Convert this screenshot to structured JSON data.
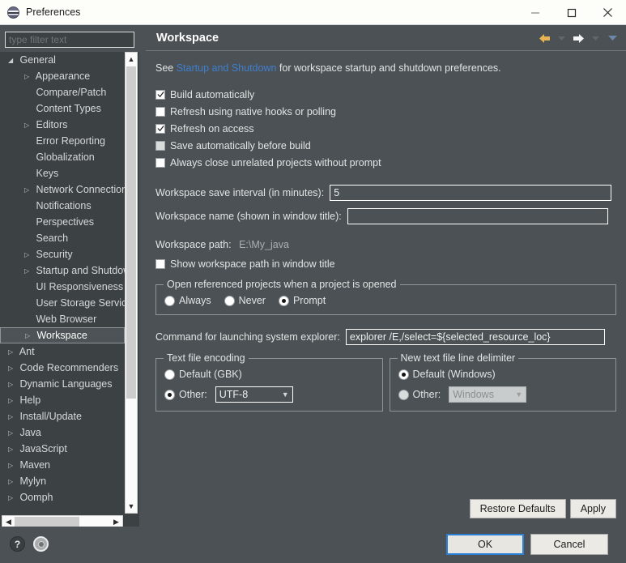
{
  "window": {
    "title": "Preferences",
    "app_icon": "eclipse-icon",
    "controls": {
      "minimize": "minimize-icon",
      "maximize": "maximize-icon",
      "close": "close-icon"
    }
  },
  "sidebar": {
    "filter_placeholder": "type filter text",
    "filter_value": "",
    "items": [
      {
        "label": "General",
        "level": 1,
        "arrow": "expanded",
        "selected": false
      },
      {
        "label": "Appearance",
        "level": 2,
        "arrow": "collapsed",
        "selected": false
      },
      {
        "label": "Compare/Patch",
        "level": 2,
        "arrow": "none",
        "selected": false
      },
      {
        "label": "Content Types",
        "level": 2,
        "arrow": "none",
        "selected": false
      },
      {
        "label": "Editors",
        "level": 2,
        "arrow": "collapsed",
        "selected": false
      },
      {
        "label": "Error Reporting",
        "level": 2,
        "arrow": "none",
        "selected": false
      },
      {
        "label": "Globalization",
        "level": 2,
        "arrow": "none",
        "selected": false
      },
      {
        "label": "Keys",
        "level": 2,
        "arrow": "none",
        "selected": false
      },
      {
        "label": "Network Connections",
        "level": 2,
        "arrow": "collapsed",
        "selected": false
      },
      {
        "label": "Notifications",
        "level": 2,
        "arrow": "none",
        "selected": false
      },
      {
        "label": "Perspectives",
        "level": 2,
        "arrow": "none",
        "selected": false
      },
      {
        "label": "Search",
        "level": 2,
        "arrow": "none",
        "selected": false
      },
      {
        "label": "Security",
        "level": 2,
        "arrow": "collapsed",
        "selected": false
      },
      {
        "label": "Startup and Shutdown",
        "level": 2,
        "arrow": "collapsed",
        "selected": false
      },
      {
        "label": "UI Responsiveness Monitoring",
        "level": 2,
        "arrow": "none",
        "selected": false
      },
      {
        "label": "User Storage Service",
        "level": 2,
        "arrow": "none",
        "selected": false
      },
      {
        "label": "Web Browser",
        "level": 2,
        "arrow": "none",
        "selected": false
      },
      {
        "label": "Workspace",
        "level": 2,
        "arrow": "collapsed",
        "selected": true
      },
      {
        "label": "Ant",
        "level": 1,
        "arrow": "collapsed",
        "selected": false
      },
      {
        "label": "Code Recommenders",
        "level": 1,
        "arrow": "collapsed",
        "selected": false
      },
      {
        "label": "Dynamic Languages",
        "level": 1,
        "arrow": "collapsed",
        "selected": false
      },
      {
        "label": "Help",
        "level": 1,
        "arrow": "collapsed",
        "selected": false
      },
      {
        "label": "Install/Update",
        "level": 1,
        "arrow": "collapsed",
        "selected": false
      },
      {
        "label": "Java",
        "level": 1,
        "arrow": "collapsed",
        "selected": false
      },
      {
        "label": "JavaScript",
        "level": 1,
        "arrow": "collapsed",
        "selected": false
      },
      {
        "label": "Maven",
        "level": 1,
        "arrow": "collapsed",
        "selected": false
      },
      {
        "label": "Mylyn",
        "level": 1,
        "arrow": "collapsed",
        "selected": false
      },
      {
        "label": "Oomph",
        "level": 1,
        "arrow": "collapsed",
        "selected": false
      }
    ],
    "scroll_up_icon": "chevron-up-icon",
    "scroll_down_icon": "chevron-down-icon",
    "scroll_left_icon": "chevron-left-icon",
    "scroll_right_icon": "chevron-right-icon"
  },
  "page": {
    "title": "Workspace",
    "nav": {
      "back_icon": "back-arrow-icon",
      "back_menu_icon": "chevron-down-icon",
      "forward_icon": "forward-arrow-icon",
      "forward_menu_icon": "chevron-down-icon",
      "view_menu_icon": "chevron-down-icon",
      "back_color": "#e8b452",
      "forward_color": "#f4f6f7",
      "menu_color": "#6d87a8"
    },
    "description": {
      "prefix": "See ",
      "link": "Startup and Shutdown",
      "suffix": " for workspace startup and shutdown preferences."
    },
    "checkboxes": [
      {
        "label": "Build automatically",
        "checked": true,
        "enabled": true
      },
      {
        "label": "Refresh using native hooks or polling",
        "checked": false,
        "enabled": true
      },
      {
        "label": "Refresh on access",
        "checked": true,
        "enabled": true
      },
      {
        "label": "Save automatically before build",
        "checked": false,
        "enabled": false
      },
      {
        "label": "Always close unrelated projects without prompt",
        "checked": false,
        "enabled": true
      }
    ],
    "save_interval": {
      "label": "Workspace save interval (in minutes):",
      "value": "5"
    },
    "workspace_name": {
      "label": "Workspace name (shown in window title):",
      "value": ""
    },
    "workspace_path": {
      "label": "Workspace path:",
      "value": "E:\\My_java"
    },
    "show_path_checkbox": {
      "label": "Show workspace path in window title",
      "checked": false
    },
    "open_referenced": {
      "title": "Open referenced projects when a project is opened",
      "options": [
        "Always",
        "Never",
        "Prompt"
      ],
      "selected": "Prompt"
    },
    "explorer_command": {
      "label": "Command for launching system explorer:",
      "value": "explorer /E,/select=${selected_resource_loc}"
    },
    "text_file_encoding": {
      "title": "Text file encoding",
      "default_label": "Default (GBK)",
      "other_label": "Other:",
      "selected": "Other",
      "combo_value": "UTF-8",
      "combo_arrow_icon": "chevron-down-icon"
    },
    "line_delimiter": {
      "title": "New text file line delimiter",
      "default_label": "Default (Windows)",
      "other_label": "Other:",
      "selected": "Default",
      "combo_value": "Windows",
      "combo_arrow_icon": "chevron-down-icon"
    },
    "restore_defaults_label": "Restore Defaults",
    "apply_label": "Apply"
  },
  "footer": {
    "help_icon": "help-icon",
    "settings_icon": "gear-icon",
    "ok_label": "OK",
    "cancel_label": "Cancel"
  }
}
